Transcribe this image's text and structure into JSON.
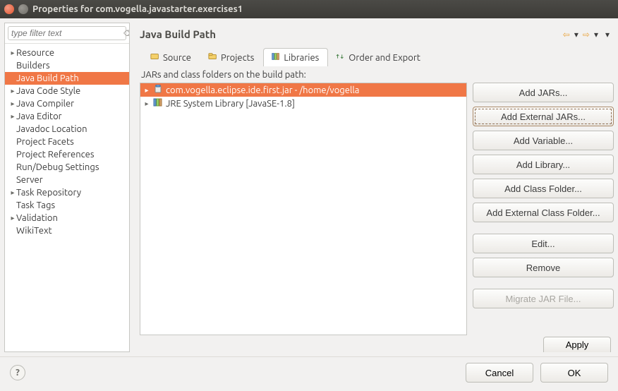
{
  "window": {
    "title": "Properties for com.vogella.javastarter.exercises1"
  },
  "filter": {
    "placeholder": "type filter text"
  },
  "sidebar": {
    "items": [
      {
        "label": "Resource",
        "expandable": true
      },
      {
        "label": "Builders",
        "expandable": false
      },
      {
        "label": "Java Build Path",
        "expandable": false,
        "selected": true
      },
      {
        "label": "Java Code Style",
        "expandable": true
      },
      {
        "label": "Java Compiler",
        "expandable": true
      },
      {
        "label": "Java Editor",
        "expandable": true
      },
      {
        "label": "Javadoc Location",
        "expandable": false
      },
      {
        "label": "Project Facets",
        "expandable": false
      },
      {
        "label": "Project References",
        "expandable": false
      },
      {
        "label": "Run/Debug Settings",
        "expandable": false
      },
      {
        "label": "Server",
        "expandable": false
      },
      {
        "label": "Task Repository",
        "expandable": true
      },
      {
        "label": "Task Tags",
        "expandable": false
      },
      {
        "label": "Validation",
        "expandable": true
      },
      {
        "label": "WikiText",
        "expandable": false
      }
    ]
  },
  "header": {
    "title": "Java Build Path"
  },
  "tabs": {
    "items": [
      {
        "label": "Source"
      },
      {
        "label": "Projects"
      },
      {
        "label": "Libraries",
        "active": true
      },
      {
        "label": "Order and Export"
      }
    ]
  },
  "list": {
    "caption": "JARs and class folders on the build path:",
    "rows": [
      {
        "label": "com.vogella.eclipse.ide.first.jar - /home/vogella",
        "expandable": true,
        "selected": true,
        "icon": "jar"
      },
      {
        "label": "JRE System Library [JavaSE-1.8]",
        "expandable": true,
        "icon": "lib"
      }
    ]
  },
  "buttons": {
    "add_jars": "Add JARs...",
    "add_ext_jars": "Add External JARs...",
    "add_variable": "Add Variable...",
    "add_library": "Add Library...",
    "add_class_folder": "Add Class Folder...",
    "add_ext_class_folder": "Add External Class Folder...",
    "edit": "Edit...",
    "remove": "Remove",
    "migrate": "Migrate JAR File...",
    "apply": "Apply",
    "cancel": "Cancel",
    "ok": "OK"
  }
}
